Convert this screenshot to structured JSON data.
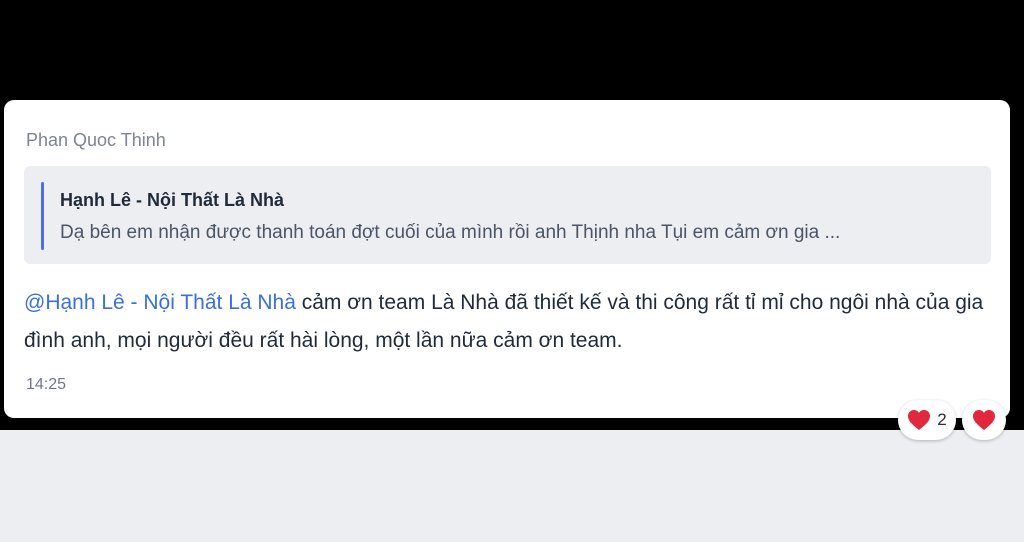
{
  "message": {
    "sender": "Phan Quoc Thinh",
    "quote": {
      "author": "Hạnh Lê - Nội Thất Là Nhà",
      "text": "Dạ bên em nhận được thanh toán đợt cuối của mình rồi anh Thịnh nha Tụi em cảm ơn gia ..."
    },
    "mention": "@Hạnh Lê - Nội Thất Là Nhà",
    "body": " cảm ơn team Là Nhà đã thiết kế và thi công rất tỉ mỉ cho ngôi nhà của gia đình anh, mọi người đều rất hài lòng, một lần nữa cảm ơn team.",
    "time": "14:25"
  },
  "reactions": [
    {
      "icon": "heart-icon",
      "count": "2"
    },
    {
      "icon": "heart-icon"
    }
  ],
  "colors": {
    "mention": "#3a6fe0",
    "quote_bar": "#4d6ee0",
    "heart": "#e0283e"
  }
}
